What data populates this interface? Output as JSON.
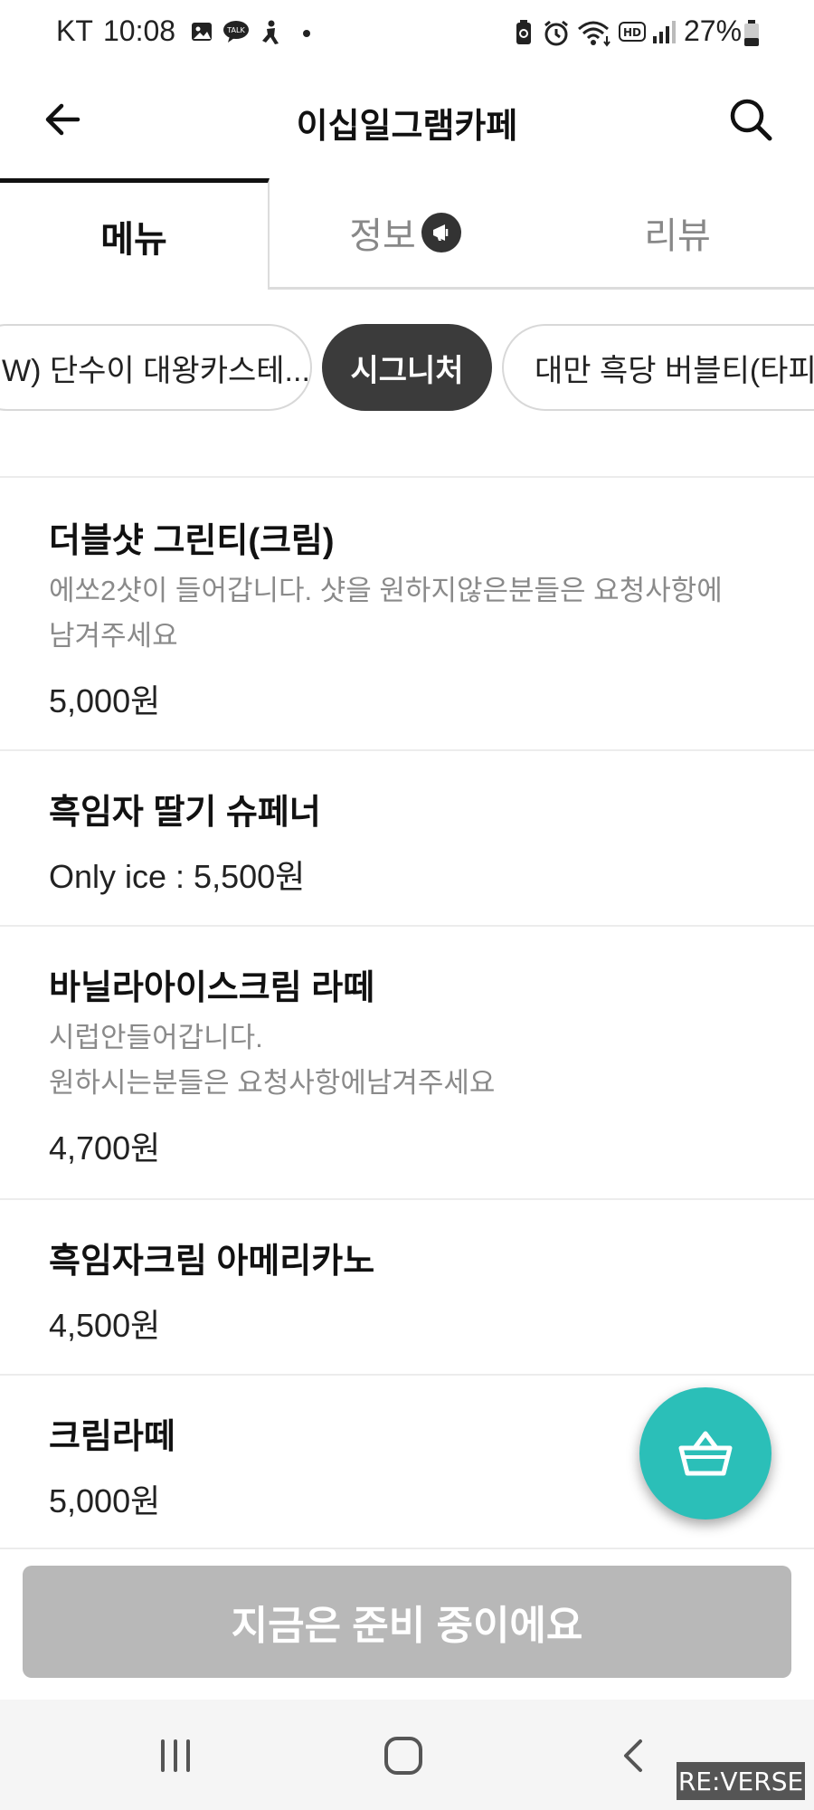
{
  "status_bar": {
    "carrier": "KT",
    "time": "10:08",
    "battery": "27%",
    "left_icons": [
      "gallery-icon",
      "talk-icon",
      "accessibility-icon",
      "dot-icon"
    ],
    "right_icons": [
      "battery-saver-icon",
      "alarm-icon",
      "wifi-icon",
      "hd-icon",
      "signal-icon",
      "battery-icon"
    ]
  },
  "header": {
    "title": "이십일그램카페",
    "back_icon": "back-arrow-icon",
    "search_icon": "search-icon"
  },
  "tabs": [
    {
      "label": "메뉴",
      "active": true
    },
    {
      "label": "정보",
      "active": false,
      "badge_icon": "megaphone-icon"
    },
    {
      "label": "리뷰",
      "active": false
    }
  ],
  "categories": [
    {
      "label": "W) 단수이 대왕카스테...",
      "active": false
    },
    {
      "label": "시그니처",
      "active": true
    },
    {
      "label": "대만 흑당 버블티(타피오",
      "active": false
    }
  ],
  "menu_items": [
    {
      "name": "더블샷 그린티(크림)",
      "description_lines": [
        "에쏘2샷이 들어갑니다. 샷을 원하지않은분들은 요청사항에",
        "남겨주세요"
      ],
      "price": "5,000원"
    },
    {
      "name": "흑임자 딸기 슈페너",
      "description_lines": [],
      "price": "Only ice : 5,500원"
    },
    {
      "name": "바닐라아이스크림 라떼",
      "description_lines": [
        "시럽안들어갑니다.",
        "원하시는분들은 요청사항에남겨주세요"
      ],
      "price": "4,700원"
    },
    {
      "name": "흑임자크림 아메리카노",
      "description_lines": [],
      "price": "4,500원"
    },
    {
      "name": "크림라떼",
      "description_lines": [],
      "price": "5,000원"
    }
  ],
  "cart_button": {
    "icon": "basket-icon"
  },
  "order_button": {
    "label": "지금은 준비 중이에요",
    "enabled": false
  },
  "nav_bar": {
    "icons": [
      "recent-apps-icon",
      "home-icon",
      "back-icon"
    ]
  },
  "watermark": "RE:VERSE",
  "colors": {
    "accent": "#2bbfb8",
    "active_chip": "#3b3b3b",
    "disabled_button": "#b8b8b8"
  }
}
